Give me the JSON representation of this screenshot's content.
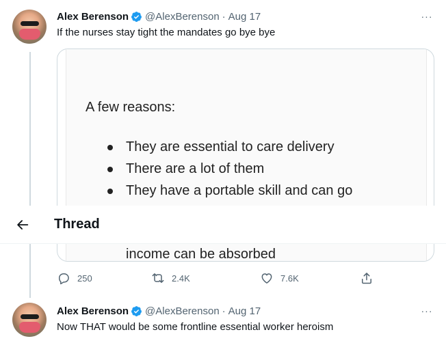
{
  "colors": {
    "accent": "#1d9bf0",
    "text": "#0f1419",
    "muted": "#536471",
    "border": "#cfd9de"
  },
  "header": {
    "back_icon": "arrow-left-icon",
    "title": "Thread"
  },
  "tweets": [
    {
      "author": "Alex Berenson",
      "handle": "@AlexBerenson",
      "separator": "·",
      "date": "Aug 17",
      "more": "···",
      "text": "If the nurses stay tight the mandates go bye bye",
      "media": {
        "heading": "A few reasons:",
        "bullets": [
          "They are essential to care delivery",
          "There are a lot of them",
          "They have a portable skill and can go"
        ],
        "tail": "income can be absorbed"
      },
      "actions": {
        "replies": "250",
        "retweets": "2.4K",
        "likes": "7.6K"
      }
    },
    {
      "author": "Alex Berenson",
      "handle": "@AlexBerenson",
      "separator": "·",
      "date": "Aug 17",
      "more": "···",
      "text": "Now THAT would be some frontline essential worker heroism"
    }
  ]
}
